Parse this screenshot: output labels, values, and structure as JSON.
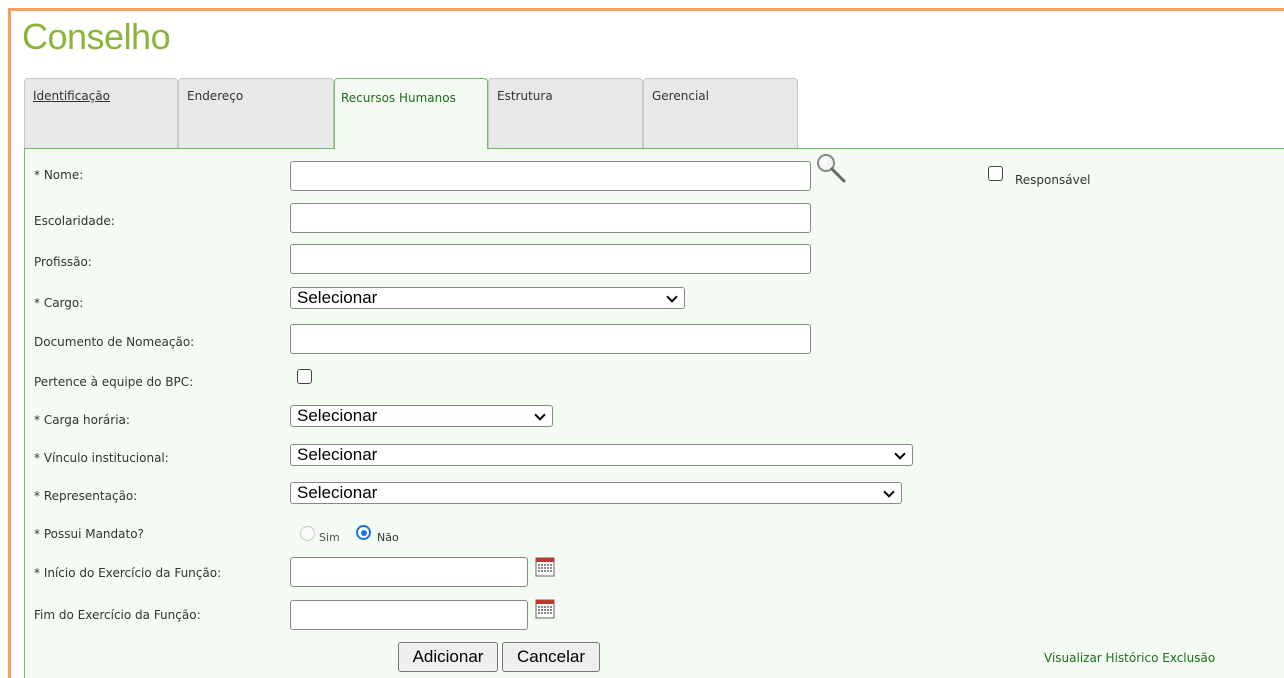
{
  "page": {
    "title": "Conselho"
  },
  "tabs": [
    {
      "label": "Identificação"
    },
    {
      "label": "Endereço"
    },
    {
      "label": "Recursos Humanos"
    },
    {
      "label": "Estrutura"
    },
    {
      "label": "Gerencial"
    }
  ],
  "active_tab": "Recursos Humanos",
  "form": {
    "nome": {
      "label": "* Nome:",
      "value": ""
    },
    "responsavel": {
      "label": "Responsável",
      "checked": false
    },
    "escolaridade": {
      "label": "Escolaridade:",
      "value": ""
    },
    "profissao": {
      "label": "Profissão:",
      "value": ""
    },
    "cargo": {
      "label": "* Cargo:",
      "selected": "Selecionar"
    },
    "documento": {
      "label": "Documento de Nomeação:",
      "value": ""
    },
    "bpc": {
      "label": "Pertence à equipe do BPC:",
      "checked": false
    },
    "carga": {
      "label": "* Carga horária:",
      "selected": "Selecionar"
    },
    "vinculo": {
      "label": "* Vínculo institucional:",
      "selected": "Selecionar"
    },
    "representacao": {
      "label": "* Representação:",
      "selected": "Selecionar"
    },
    "mandato": {
      "label": "* Possui Mandato?",
      "options": [
        "Sim",
        "Não"
      ],
      "selected": "Não"
    },
    "inicio": {
      "label": "* Início do Exercício da Função:",
      "value": ""
    },
    "fim": {
      "label": "Fim do Exercício da Função:",
      "value": ""
    }
  },
  "buttons": {
    "add": "Adicionar",
    "cancel": "Cancelar"
  },
  "links": {
    "historico": "Visualizar Histórico Exclusão"
  },
  "icons": {
    "search": "magnifier-icon",
    "calendar": "calendar-icon"
  },
  "colors": {
    "title": "#8db33a",
    "panel_bg": "#f4fbf2",
    "panel_border": "#6fbf5f",
    "frame": "#f0a060",
    "link": "#1e6b1e"
  }
}
